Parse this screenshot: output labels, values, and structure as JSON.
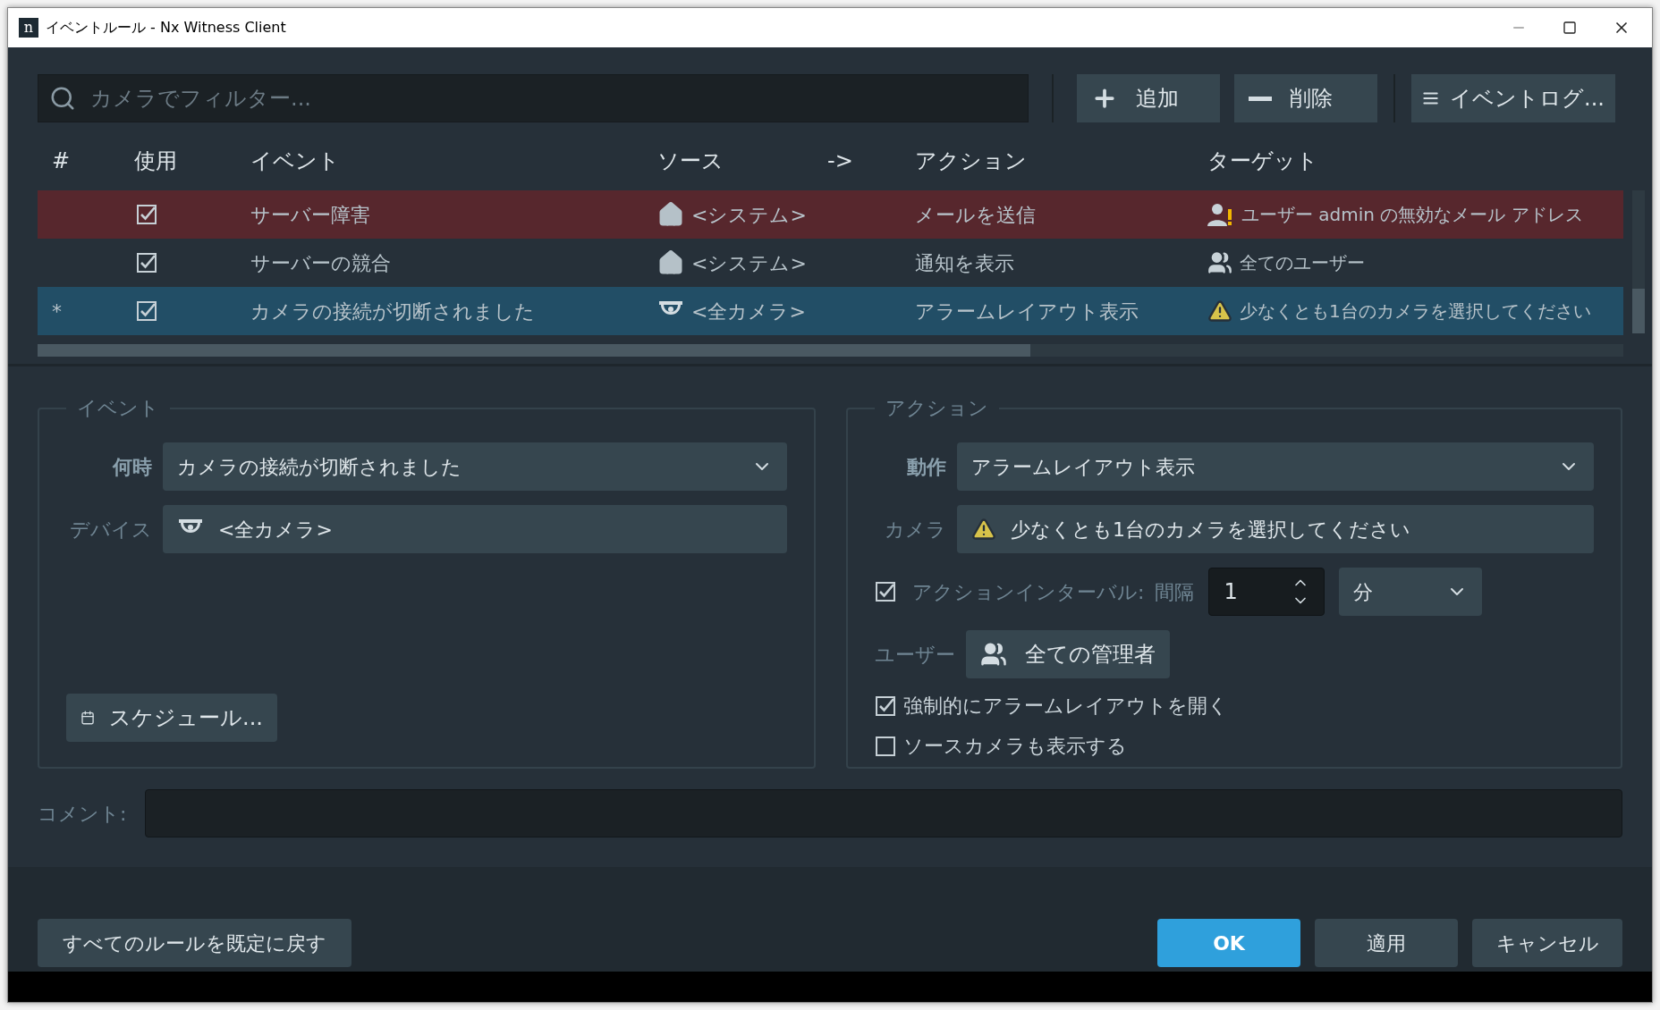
{
  "window": {
    "title": "イベントルール - Nx Witness Client",
    "logo": "n"
  },
  "search": {
    "placeholder": "カメラでフィルター..."
  },
  "toolbar": [
    {
      "kind": "add",
      "label": "追加"
    },
    {
      "kind": "remove",
      "label": "削除"
    },
    {
      "kind": "log",
      "label": "イベントログ..."
    }
  ],
  "table": {
    "columns": [
      "#",
      "使用",
      "イベント",
      "ソース",
      "->",
      "アクション",
      "ターゲット"
    ],
    "rows": [
      {
        "marker": "",
        "enabled": true,
        "event": "サーバー障害",
        "source": {
          "kind": "system",
          "label": "<システム>"
        },
        "action": "メールを送信",
        "target": "ユーザー admin の無効なメール アドレス",
        "kind": "error",
        "selected": false
      },
      {
        "marker": "",
        "enabled": true,
        "event": "サーバーの競合",
        "source": {
          "kind": "system",
          "label": "<システム>"
        },
        "action": "通知を表示",
        "target": "全てのユーザー",
        "kind": "ok",
        "selected": false
      },
      {
        "marker": "*",
        "enabled": true,
        "event": "カメラの接続が切断されました",
        "source": {
          "kind": "cameras",
          "label": "<全カメラ>"
        },
        "action": "アラームレイアウト表示",
        "target": "少なくとも1台のカメラを選択してください",
        "kind": "invalid",
        "selected": true
      }
    ]
  },
  "event_panel": {
    "title": "イベント",
    "when": {
      "label": "何時",
      "value": "カメラの接続が切断されました"
    },
    "device": {
      "label": "デバイス",
      "value": "<全カメラ>"
    },
    "schedule_button": "スケジュール..."
  },
  "action_panel": {
    "title": "アクション",
    "action": {
      "label": "動作",
      "value": "アラームレイアウト表示"
    },
    "camera": {
      "label": "カメラ",
      "value": "少なくとも1台のカメラを選択してください"
    },
    "interval": {
      "checked": true,
      "label": "アクションインターバル:",
      "sublabel": "間隔",
      "value": "1",
      "unit": "分"
    },
    "users": {
      "label": "ユーザー",
      "value": "全ての管理者"
    },
    "options": [
      {
        "label": "強制的にアラームレイアウトを開く",
        "checked": true
      },
      {
        "label": "ソースカメラも表示する",
        "checked": false
      }
    ]
  },
  "comment": {
    "label": "コメント:"
  },
  "buttons": {
    "reset": "すべてのルールを既定に戻す",
    "ok": "OK",
    "apply": "適用",
    "cancel": "キャンセル"
  }
}
